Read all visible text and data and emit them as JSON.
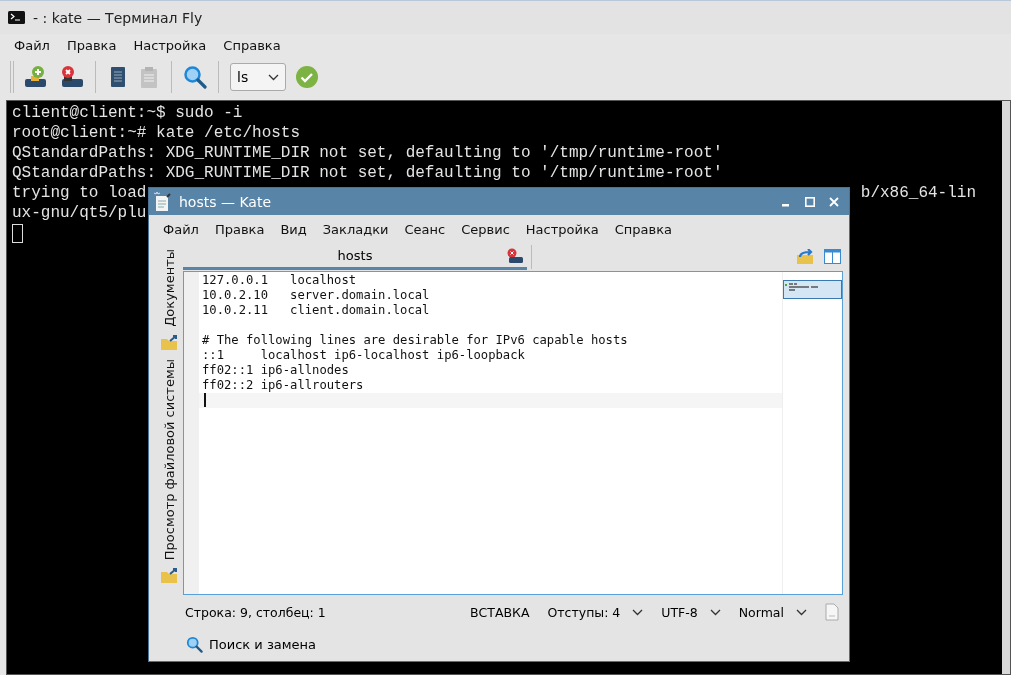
{
  "terminal": {
    "title": "- : kate — Терминал Fly",
    "menu": [
      "Файл",
      "Правка",
      "Настройка",
      "Справка"
    ],
    "toolbar": [
      {
        "kind": "add",
        "disabled": false
      },
      {
        "kind": "remove",
        "disabled": false
      },
      {
        "kind": "sep"
      },
      {
        "kind": "copy",
        "disabled": false
      },
      {
        "kind": "paste",
        "disabled": true
      },
      {
        "kind": "sep"
      },
      {
        "kind": "search",
        "disabled": false
      },
      {
        "kind": "sep"
      }
    ],
    "command": {
      "value": "ls"
    },
    "output": [
      {
        "text": "client@client:~$ sudo -i"
      },
      {
        "text": "root@client:~# kate /etc/hosts"
      },
      {
        "text": "QStandardPaths: XDG_RUNTIME_DIR not set, defaulting to '/tmp/runtime-root'"
      },
      {
        "text": "QStandardPaths: XDG_RUNTIME_DIR not set, defaulting to '/tmp/runtime-root'"
      },
      {
        "text": "trying to load",
        "tail": "b/x86_64-lin"
      },
      {
        "text": "ux-gnu/qt5/plu"
      }
    ]
  },
  "kate": {
    "title": "hosts  — Kate",
    "menu": [
      "Файл",
      "Правка",
      "Вид",
      "Закладки",
      "Сеанс",
      "Сервис",
      "Настройка",
      "Справка"
    ],
    "side_tabs": [
      {
        "label": "Документы"
      },
      {
        "label": "Просмотр файловой системы"
      }
    ],
    "document_tab": {
      "label": "hosts"
    },
    "lines": [
      {
        "kind": "text",
        "text": "127.0.0.1\tlocalhost"
      },
      {
        "kind": "text",
        "text": "10.0.2.10   server.domain.local"
      },
      {
        "kind": "text",
        "text": "10.0.2.11   client.domain.local"
      },
      {
        "kind": "blank"
      },
      {
        "kind": "text",
        "text": "# The following lines are desirable for IPv6 capable hosts"
      },
      {
        "kind": "text",
        "text": "::1     localhost ip6-localhost ip6-loopback"
      },
      {
        "kind": "text",
        "text": "ff02::1 ip6-allnodes"
      },
      {
        "kind": "text",
        "text": "ff02::2 ip6-allrouters"
      },
      {
        "kind": "cursor"
      }
    ],
    "status": {
      "position": "Строка: 9, столбец: 1",
      "mode": "ВСТАВКА",
      "indent": "Отступы: 4",
      "encoding": "UTF-8",
      "syntax": "Normal"
    },
    "search_bar": {
      "label": "Поиск и замена"
    }
  }
}
